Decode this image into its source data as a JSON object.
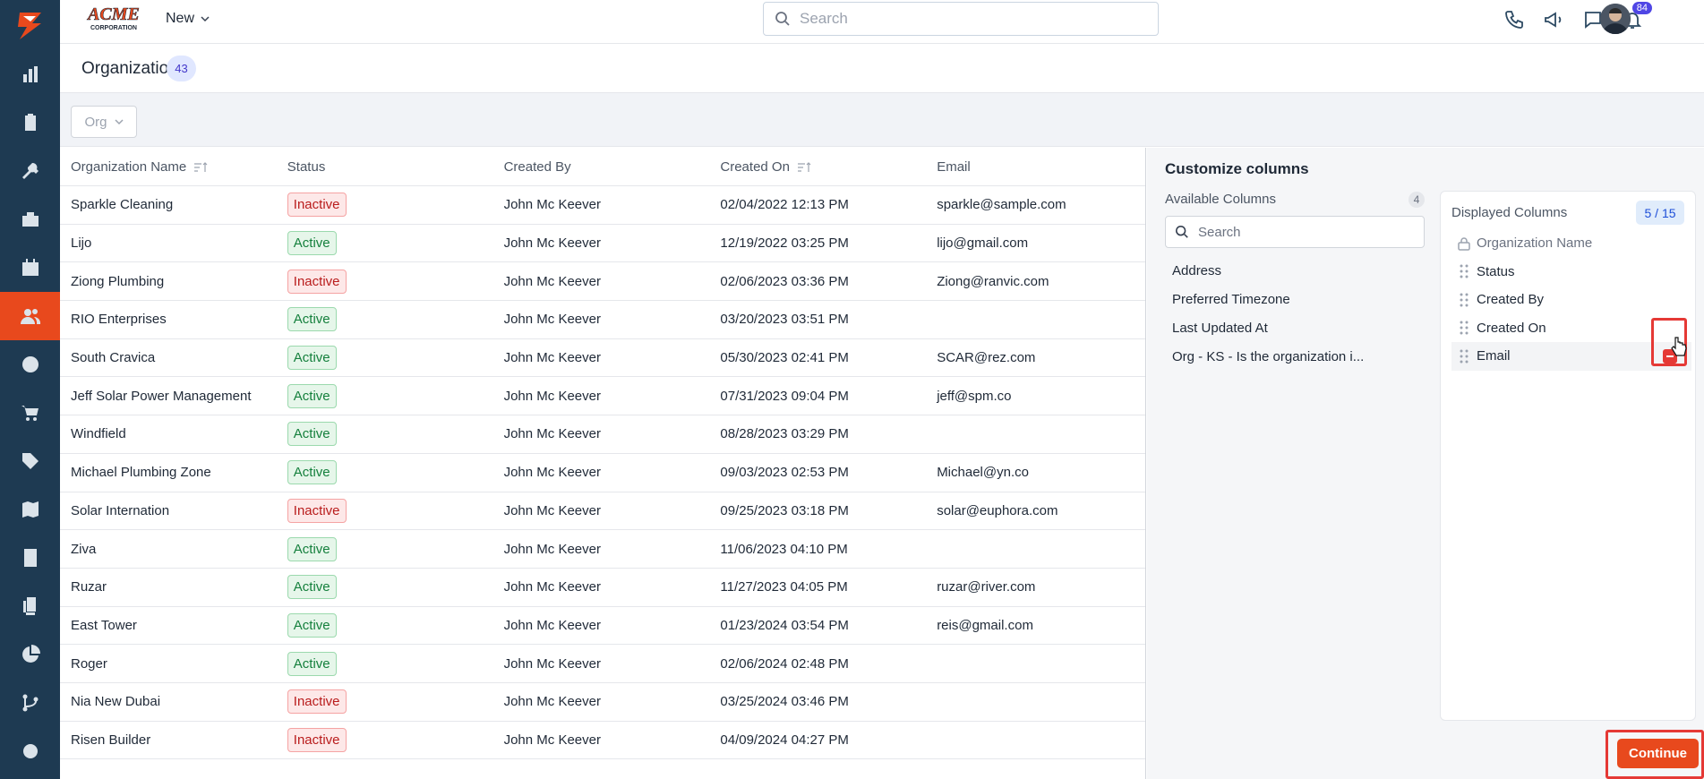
{
  "brand": {
    "name": "ACME",
    "sub": "CORPORATION"
  },
  "topbar": {
    "new_label": "New",
    "search_placeholder": "Search",
    "notification_count": "84"
  },
  "header": {
    "title": "Organizations",
    "count": "43"
  },
  "filter": {
    "org_label": "Org"
  },
  "table": {
    "columns": [
      "Organization Name",
      "Status",
      "Created By",
      "Created On",
      "Email"
    ],
    "rows": [
      {
        "name": "Sparkle Cleaning",
        "status": "Inactive",
        "created_by": "John Mc Keever",
        "created_on": "02/04/2022 12:13 PM",
        "email": "sparkle@sample.com"
      },
      {
        "name": "Lijo",
        "status": "Active",
        "created_by": "John Mc Keever",
        "created_on": "12/19/2022 03:25 PM",
        "email": "lijo@gmail.com"
      },
      {
        "name": "Ziong Plumbing",
        "status": "Inactive",
        "created_by": "John Mc Keever",
        "created_on": "02/06/2023 03:36 PM",
        "email": "Ziong@ranvic.com"
      },
      {
        "name": "RIO Enterprises",
        "status": "Active",
        "created_by": "John Mc Keever",
        "created_on": "03/20/2023 03:51 PM",
        "email": ""
      },
      {
        "name": "South Cravica",
        "status": "Active",
        "created_by": "John Mc Keever",
        "created_on": "05/30/2023 02:41 PM",
        "email": "SCAR@rez.com"
      },
      {
        "name": "Jeff Solar Power Management",
        "status": "Active",
        "created_by": "John Mc Keever",
        "created_on": "07/31/2023 09:04 PM",
        "email": "jeff@spm.co"
      },
      {
        "name": "Windfield",
        "status": "Active",
        "created_by": "John Mc Keever",
        "created_on": "08/28/2023 03:29 PM",
        "email": ""
      },
      {
        "name": "Michael Plumbing Zone",
        "status": "Active",
        "created_by": "John Mc Keever",
        "created_on": "09/03/2023 02:53 PM",
        "email": "Michael@yn.co"
      },
      {
        "name": "Solar Internation",
        "status": "Inactive",
        "created_by": "John Mc Keever",
        "created_on": "09/25/2023 03:18 PM",
        "email": "solar@euphora.com"
      },
      {
        "name": "Ziva",
        "status": "Active",
        "created_by": "John Mc Keever",
        "created_on": "11/06/2023 04:10 PM",
        "email": ""
      },
      {
        "name": "Ruzar",
        "status": "Active",
        "created_by": "John Mc Keever",
        "created_on": "11/27/2023 04:05 PM",
        "email": "ruzar@river.com"
      },
      {
        "name": "East Tower",
        "status": "Active",
        "created_by": "John Mc Keever",
        "created_on": "01/23/2024 03:54 PM",
        "email": "reis@gmail.com"
      },
      {
        "name": "Roger",
        "status": "Active",
        "created_by": "John Mc Keever",
        "created_on": "02/06/2024 02:48 PM",
        "email": ""
      },
      {
        "name": "Nia New Dubai",
        "status": "Inactive",
        "created_by": "John Mc Keever",
        "created_on": "03/25/2024 03:46 PM",
        "email": ""
      },
      {
        "name": "Risen Builder",
        "status": "Inactive",
        "created_by": "John Mc Keever",
        "created_on": "04/09/2024 04:27 PM",
        "email": ""
      }
    ]
  },
  "customize": {
    "title": "Customize columns",
    "available_label": "Available Columns",
    "available_count": "4",
    "search_placeholder": "Search",
    "available": [
      "Address",
      "Preferred Timezone",
      "Last Updated At",
      "Org - KS - Is the organization i..."
    ],
    "displayed_label": "Displayed Columns",
    "displayed_count": "5 / 15",
    "displayed": [
      "Organization Name",
      "Status",
      "Created By",
      "Created On",
      "Email"
    ],
    "continue_label": "Continue"
  },
  "colors": {
    "accent": "#e8491d",
    "sidebar": "#1e3a52",
    "highlight": "#e53935"
  }
}
